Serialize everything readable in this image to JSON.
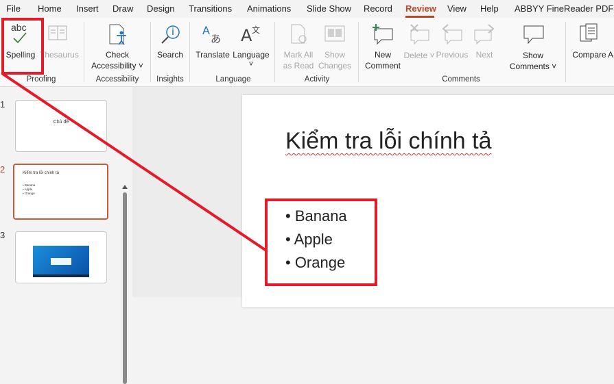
{
  "menu": {
    "items": [
      "File",
      "Home",
      "Insert",
      "Draw",
      "Design",
      "Transitions",
      "Animations",
      "Slide Show",
      "Record",
      "Review",
      "View",
      "Help",
      "ABBYY FineReader PDF"
    ],
    "active": "Review"
  },
  "ribbon": {
    "spelling": "Spelling",
    "thesaurus": "Thesaurus",
    "check_accessibility_1": "Check",
    "check_accessibility_2": "Accessibility ˅",
    "search": "Search",
    "translate": "Translate",
    "language": "Language",
    "language_caret": "˅",
    "mark_all_1": "Mark All",
    "mark_all_2": "as Read",
    "show_changes_1": "Show",
    "show_changes_2": "Changes",
    "new_comment_1": "New",
    "new_comment_2": "Comment",
    "delete": "Delete ˅",
    "previous": "Previous",
    "next": "Next",
    "show_comments_1": "Show",
    "show_comments_2": "Comments ˅",
    "compare": "Compare",
    "compare_cut": "A",
    "spelling_icon_text": "abc",
    "groups": {
      "proofing": "Proofing",
      "accessibility": "Accessibility",
      "insights": "Insights",
      "language": "Language",
      "activity": "Activity",
      "comments": "Comments"
    }
  },
  "thumbnails": {
    "slide1": {
      "number": "1",
      "title": "Chủ đề"
    },
    "slide2": {
      "number": "2",
      "title": "Kiểm tra lỗi chính tả",
      "bullets": [
        "• Banana",
        "• Apple",
        "• Orange"
      ]
    },
    "slide3": {
      "number": "3"
    }
  },
  "slide": {
    "title": "Kiểm tra lỗi chính tả",
    "bullets": [
      "• Banana",
      "• Apple",
      "• Orange"
    ]
  },
  "colors": {
    "accent": "#b7472a",
    "highlight": "#e31c2a"
  }
}
